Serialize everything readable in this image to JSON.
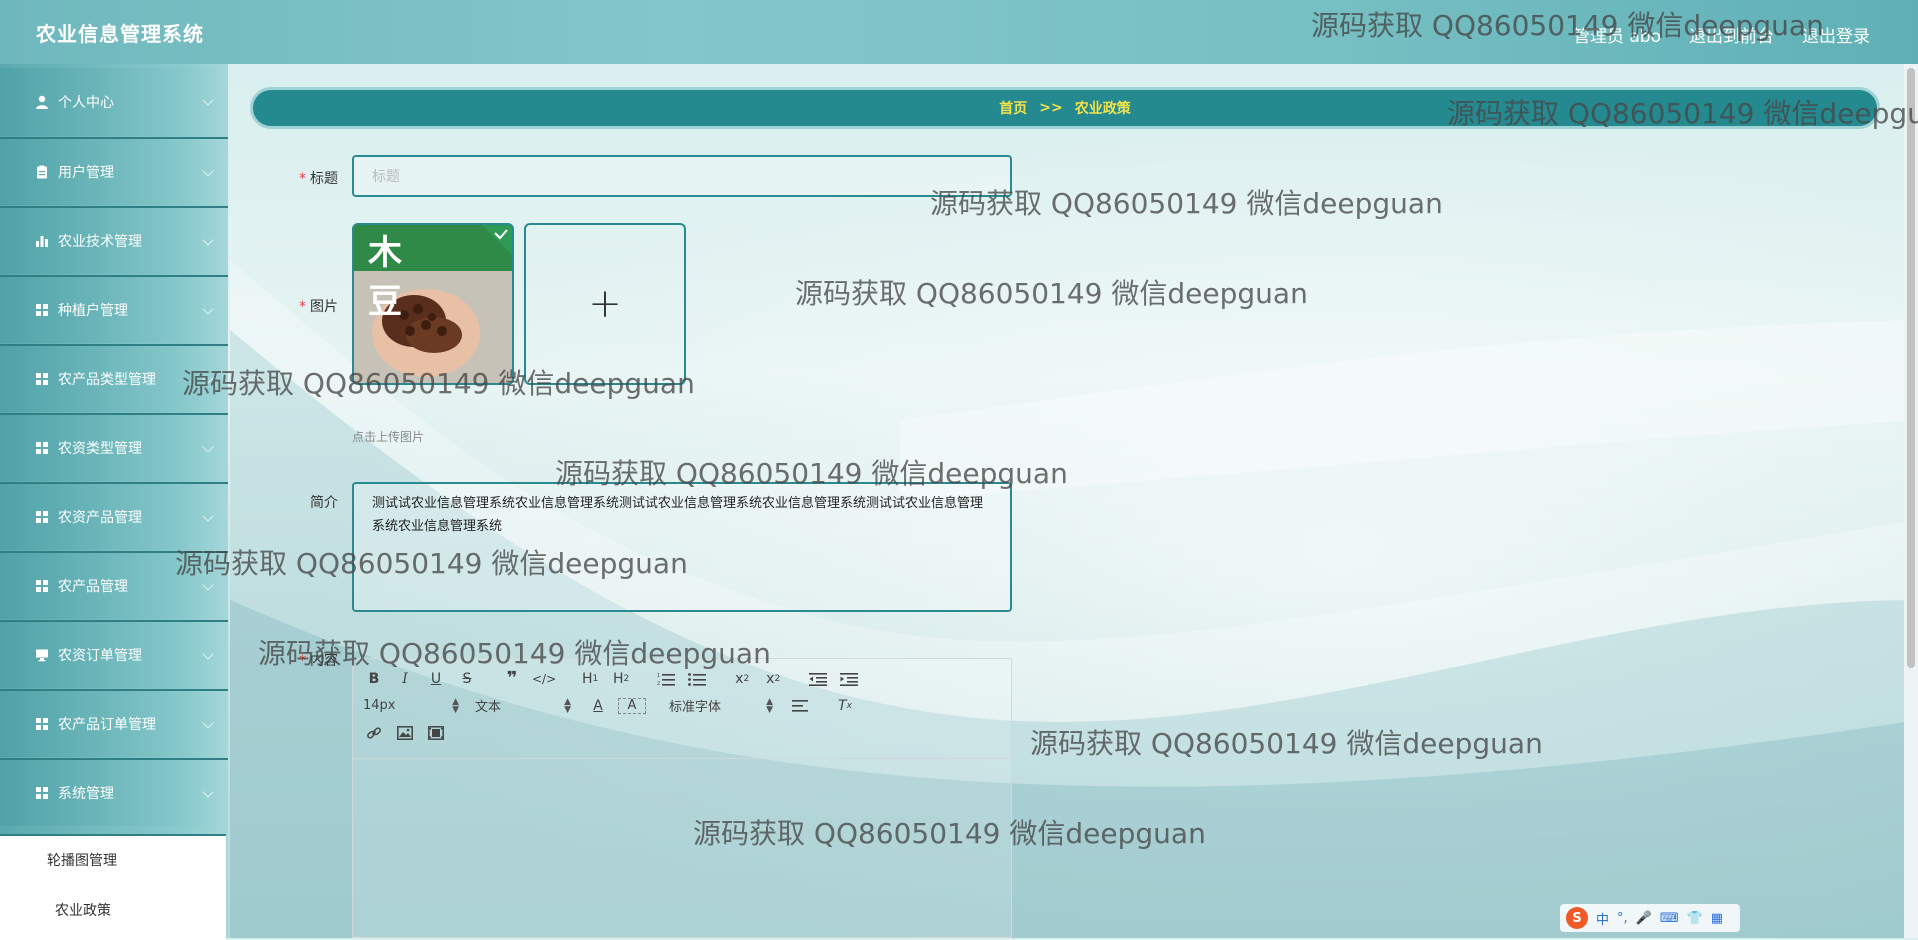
{
  "app": {
    "title": "农业信息管理系统",
    "user": "管理员 abo",
    "back_to_front": "退出到前台",
    "logout": "退出登录"
  },
  "sidebar": {
    "items": [
      {
        "label": "个人中心",
        "icon": "user-icon"
      },
      {
        "label": "用户管理",
        "icon": "clipboard-icon"
      },
      {
        "label": "农业技术管理",
        "icon": "bar-chart-icon"
      },
      {
        "label": "种植户管理",
        "icon": "grid-icon"
      },
      {
        "label": "农产品类型管理",
        "icon": "grid-icon"
      },
      {
        "label": "农资类型管理",
        "icon": "grid-icon"
      },
      {
        "label": "农资产品管理",
        "icon": "grid-icon"
      },
      {
        "label": "农产品管理",
        "icon": "grid-icon"
      },
      {
        "label": "农资订单管理",
        "icon": "monitor-icon"
      },
      {
        "label": "农产品订单管理",
        "icon": "grid-icon"
      },
      {
        "label": "系统管理",
        "icon": "grid-icon"
      }
    ],
    "submenu": [
      "轮播图管理",
      "农业政策"
    ]
  },
  "breadcrumb": {
    "home": "首页",
    "separator": ">>",
    "current": "农业政策"
  },
  "form": {
    "title_label": "标题",
    "title_value": "",
    "title_placeholder": "标题",
    "image_label": "图片",
    "upload_hint": "点击上传图片",
    "image_text_top": "木 豆",
    "intro_label": "简介",
    "intro_value": "测试试农业信息管理系统农业信息管理系统测试试农业信息管理系统农业信息管理系统测试试农业信息管理系统农业信息管理系统",
    "content_label": "内容"
  },
  "editor": {
    "font_size": "14px",
    "paragraph": "文本",
    "font_family": "标准字体"
  },
  "watermark_text": "源码获取 QQ86050149 微信deepguan",
  "colors": {
    "accent": "#258a90",
    "breadcrumb_text": "#f3e24a",
    "required": "#e83b3b"
  }
}
